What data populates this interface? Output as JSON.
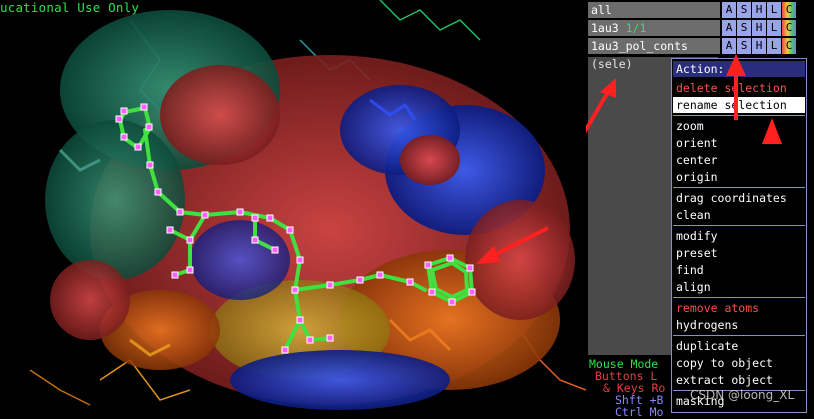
{
  "viewport": {
    "edu_banner": "ucational Use Only",
    "watermark": "CSDN @loong_XL"
  },
  "objects": [
    {
      "name": "all",
      "count": "",
      "buttons": [
        "A",
        "S",
        "H",
        "L",
        "C"
      ]
    },
    {
      "name": "1au3",
      "count": "1/1",
      "buttons": [
        "A",
        "S",
        "H",
        "L",
        "C"
      ]
    },
    {
      "name": "1au3_pol_conts",
      "count": "",
      "buttons": [
        "A",
        "S",
        "H",
        "L",
        "C"
      ]
    }
  ],
  "selection": {
    "name": "(sele)"
  },
  "action_menu": {
    "title": "Action:",
    "items": [
      {
        "label": "delete selection",
        "style": "red"
      },
      {
        "label": "rename selection",
        "style": "highlight"
      },
      {
        "label": "zoom",
        "style": "normal"
      },
      {
        "label": "orient",
        "style": "normal"
      },
      {
        "label": "center",
        "style": "normal"
      },
      {
        "label": "origin",
        "style": "normal"
      },
      {
        "label": "drag coordinates",
        "style": "normal"
      },
      {
        "label": "clean",
        "style": "normal"
      },
      {
        "label": "modify",
        "style": "normal"
      },
      {
        "label": "preset",
        "style": "normal"
      },
      {
        "label": "find",
        "style": "normal"
      },
      {
        "label": "align",
        "style": "normal"
      },
      {
        "label": "remove atoms",
        "style": "red"
      },
      {
        "label": "hydrogens",
        "style": "normal"
      },
      {
        "label": "duplicate",
        "style": "normal"
      },
      {
        "label": "copy to object",
        "style": "normal"
      },
      {
        "label": "extract object",
        "style": "normal"
      },
      {
        "label": "masking",
        "style": "normal"
      }
    ]
  },
  "mouse_mode": {
    "title": "Mouse Mode",
    "lines": [
      "Buttons  L",
      "& Keys  Ro",
      "Shft  +B",
      "Ctrl  Mo"
    ]
  },
  "colors": {
    "accent_green": "#2fe04a",
    "menu_red": "#ff4d4d",
    "annotation_arrow": "#ff2020"
  },
  "icons": [
    "red-annotation-arrow"
  ]
}
